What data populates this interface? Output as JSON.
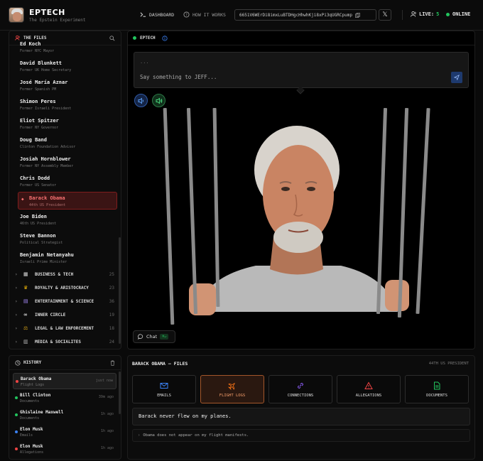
{
  "header": {
    "brand": "EPTECH",
    "tagline": "The Epstein Experiment",
    "nav": [
      {
        "label": "DASHBOARD",
        "icon": "terminal-icon"
      },
      {
        "label": "HOW IT WORKS",
        "icon": "help-circle-icon"
      }
    ],
    "token": "6651V6WErDi8imxLuBTDHgcHhwhKji8xPi3qUGRCpump",
    "live_label": "LIVE:",
    "live_count": "5",
    "online_label": "ONLINE"
  },
  "files_panel": {
    "title": "THE FILES",
    "people": [
      {
        "name": "Ed Koch",
        "desc": "Former NYC Mayor"
      },
      {
        "name": "David Blunkett",
        "desc": "Former UK Home Secretary"
      },
      {
        "name": "José María Aznar",
        "desc": "Former Spanish PM"
      },
      {
        "name": "Shimon Peres",
        "desc": "Former Israeli President"
      },
      {
        "name": "Eliot Spitzer",
        "desc": "Former NY Governor"
      },
      {
        "name": "Doug Band",
        "desc": "Clinton Foundation Advisor"
      },
      {
        "name": "Josiah Hornblower",
        "desc": "Former NY Assembly Member"
      },
      {
        "name": "Chris Dodd",
        "desc": "Former US Senator"
      },
      {
        "name": "Barack Obama",
        "desc": "44th US President",
        "active": true
      },
      {
        "name": "Joe Biden",
        "desc": "46th US President"
      },
      {
        "name": "Steve Bannon",
        "desc": "Political Strategist"
      },
      {
        "name": "Benjamin Netanyahu",
        "desc": "Israeli Prime Minister"
      }
    ],
    "categories": [
      {
        "label": "BUSINESS & TECH",
        "count": "25",
        "emoji": "🏢"
      },
      {
        "label": "ROYALTY & ARISTOCRACY",
        "count": "23",
        "emoji": "👑"
      },
      {
        "label": "ENTERTAINMENT & SCIENCE",
        "count": "36",
        "emoji": "🎬"
      },
      {
        "label": "INNER CIRCLE",
        "count": "19",
        "emoji": "🔗"
      },
      {
        "label": "LEGAL & LAW ENFORCEMENT",
        "count": "18",
        "emoji": "⚖"
      },
      {
        "label": "MEDIA & SOCIALITES",
        "count": "24",
        "emoji": "📰"
      }
    ]
  },
  "history": {
    "title": "HISTORY",
    "items": [
      {
        "name": "Barack Obama",
        "sub": "Flight Logs",
        "time": "just now",
        "color": "#ef4444"
      },
      {
        "name": "Bill Clinton",
        "sub": "Documents",
        "time": "39m ago",
        "color": "#22c55e"
      },
      {
        "name": "Ghislaine Maxwell",
        "sub": "Documents",
        "time": "1h ago",
        "color": "#22c55e"
      },
      {
        "name": "Elon Musk",
        "sub": "Emails",
        "time": "1h ago",
        "color": "#3b82f6"
      },
      {
        "name": "Elon Musk",
        "sub": "Allegations",
        "time": "1h ago",
        "color": "#ef4444"
      }
    ]
  },
  "stage": {
    "name": "EPTECH",
    "chat_dots": "...",
    "placeholder": "Say something to JEFF...",
    "chat_label": "Chat",
    "chat_badge": "⌘↵"
  },
  "casefile": {
    "title": "BARACK OBAMA — FILES",
    "subtitle": "44TH US PRESIDENT",
    "tabs": [
      {
        "label": "EMAILS",
        "icon": "mail-icon",
        "color": "#3b82f6"
      },
      {
        "label": "FLIGHT LOGS",
        "icon": "plane-icon",
        "color": "#f97316",
        "active": true
      },
      {
        "label": "CONNECTIONS",
        "icon": "link-icon",
        "color": "#8b5cf6"
      },
      {
        "label": "ALLEGATIONS",
        "icon": "warning-icon",
        "color": "#ef4444"
      },
      {
        "label": "DOCUMENTS",
        "icon": "document-icon",
        "color": "#22c55e"
      }
    ],
    "quote": "Barack never flew on my planes.",
    "fact": "Obama does not appear on my flight manifests."
  },
  "colors": {
    "accent_green": "#22c55e",
    "accent_red": "#ef4444",
    "accent_orange": "#f97316",
    "bg": "#0a0a0a"
  }
}
